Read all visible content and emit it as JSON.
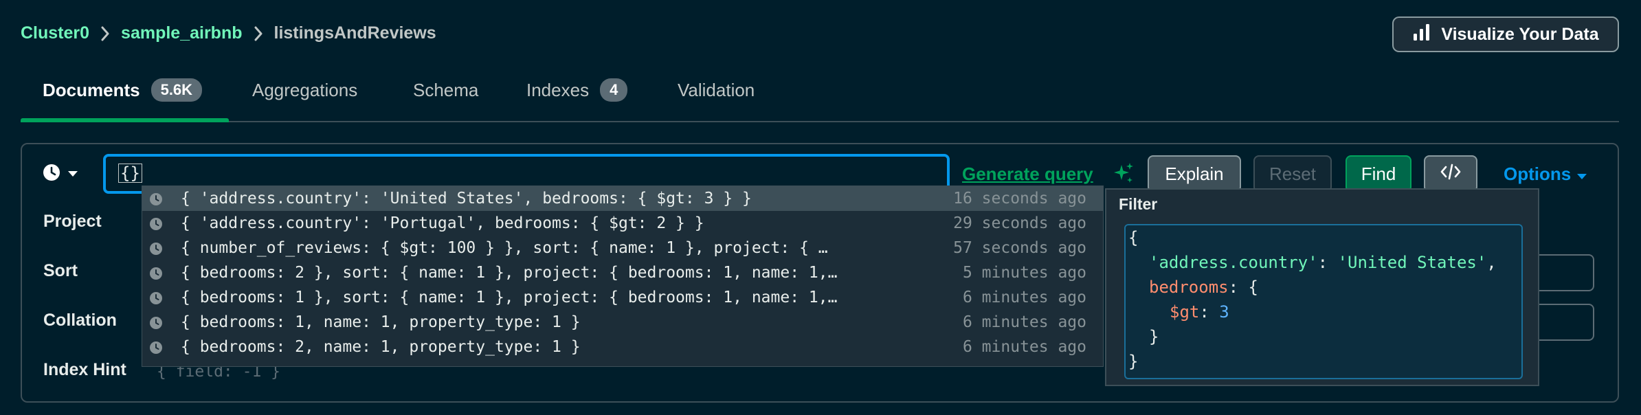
{
  "breadcrumb": {
    "cluster": "Cluster0",
    "database": "sample_airbnb",
    "collection": "listingsAndReviews"
  },
  "header": {
    "visualize_label": "Visualize Your Data"
  },
  "tabs": [
    {
      "label": "Documents",
      "badge": "5.6K"
    },
    {
      "label": "Aggregations"
    },
    {
      "label": "Schema"
    },
    {
      "label": "Indexes",
      "badge": "4"
    },
    {
      "label": "Validation"
    }
  ],
  "query_bar": {
    "filter_value": "{}",
    "generate_query_label": "Generate query",
    "explain_label": "Explain",
    "reset_label": "Reset",
    "find_label": "Find",
    "options_label": "Options"
  },
  "fields": {
    "project_label": "Project",
    "sort_label": "Sort",
    "collation_label": "Collation",
    "index_hint_label": "Index Hint",
    "index_hint_placeholder": "{ field: -1 }"
  },
  "history": [
    {
      "query": "{ 'address.country': 'United States', bedrooms: { $gt: 3 } }",
      "time": "16 seconds ago"
    },
    {
      "query": "{ 'address.country': 'Portugal', bedrooms: { $gt: 2 } }",
      "time": "29 seconds ago"
    },
    {
      "query": "{ number_of_reviews: { $gt: 100 } }, sort: { name: 1 }, project: { …",
      "time": "57 seconds ago"
    },
    {
      "query": "{ bedrooms: 2 }, sort: { name: 1 }, project: { bedrooms: 1, name: 1,…",
      "time": "5 minutes ago"
    },
    {
      "query": "{ bedrooms: 1 }, sort: { name: 1 }, project: { bedrooms: 1, name: 1,…",
      "time": "6 minutes ago"
    },
    {
      "query": "{ bedrooms: 1, name: 1, property_type: 1 }",
      "time": "6 minutes ago"
    },
    {
      "query": "{ bedrooms: 2, name: 1, property_type: 1 }",
      "time": "6 minutes ago"
    }
  ],
  "preview": {
    "title": "Filter",
    "open_brace": "{",
    "country_key": "'address.country'",
    "country_value": "'United States'",
    "bedrooms_key": "bedrooms",
    "gt_key": "$gt",
    "gt_value": "3",
    "inner_close": "}",
    "close_brace": "}"
  },
  "colors": {
    "background": "#001e2b",
    "accent_green": "#00a35c",
    "link_green": "#71f6ba",
    "focus_blue": "#0498ec"
  },
  "icons": [
    "chevron-right-icon",
    "bar-chart-icon",
    "clock-icon",
    "caret-down-icon",
    "sparkle-icon",
    "code-icon"
  ]
}
